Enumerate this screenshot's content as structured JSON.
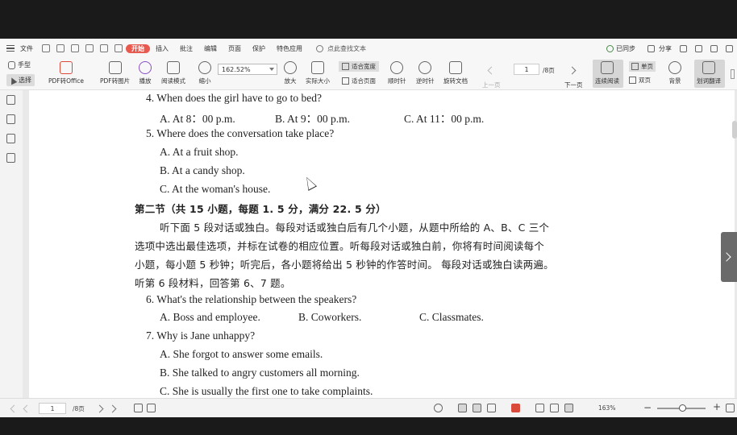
{
  "menu": {
    "file": "文件",
    "start": "开始",
    "items": [
      "插入",
      "批注",
      "编辑",
      "页面",
      "保护",
      "特色应用"
    ],
    "search": "点此查找文本",
    "sync": "已同步",
    "share": "分享"
  },
  "toolbar": {
    "hand": "手型",
    "select": "选择",
    "pdf_to_office": "PDF转Office",
    "pdf_to_image": "PDF转图片",
    "play": "播放",
    "read_mode": "阅读模式",
    "zoom_out": "缩小",
    "zoom_value": "162.52%",
    "zoom_in": "放大",
    "actual_size": "实际大小",
    "fit_width": "适合宽度",
    "fit_page": "适合页面",
    "rotate_cw": "顺时针",
    "rotate_ccw": "逆时针",
    "rotate_doc": "旋转文档",
    "prev_page": "上一页",
    "page_current": "1",
    "page_total": "/8页",
    "next_page": "下一页",
    "continuous": "连续阅读",
    "single": "单页",
    "double": "双页",
    "background": "背景",
    "translate": "划词翻译"
  },
  "document": {
    "lines": [
      "4. When does the girl have to go to bed?",
      "A. At 8：00 p.m.",
      "B. At 9：00 p.m.",
      "C. At 11：00 p.m.",
      "5. Where does the conversation take place?",
      "A. At a fruit shop.",
      "B. At a candy shop.",
      "C. At the woman's house.",
      "第二节（共 15 小题，每题 1. 5 分，满分 22. 5 分）",
      "听下面 5 段对话或独白。每段对话或独白后有几个小题，从题中所给的 A、B、C 三个",
      "选项中选出最佳选项，并标在试卷的相应位置。听每段对话或独白前，你将有时间阅读每个",
      "小题，每小题 5 秒钟；听完后，各小题将给出 5 秒钟的作答时间。 每段对话或独白读两遍。",
      "听第 6 段材料，回答第 6、7 题。",
      "6. What's the relationship between the speakers?",
      "A. Boss and employee.",
      "B. Coworkers.",
      "C. Classmates.",
      "7. Why is Jane unhappy?",
      "A. She forgot to answer some emails.",
      "B. She talked to angry customers all morning.",
      "C. She is usually the first one to take complaints."
    ]
  },
  "status": {
    "page_current": "1",
    "page_total": "/8页",
    "zoom": "163%"
  },
  "colors": {
    "accent": "#e85a4f",
    "page": "#ffffff",
    "chrome": "#f3f3f3"
  }
}
